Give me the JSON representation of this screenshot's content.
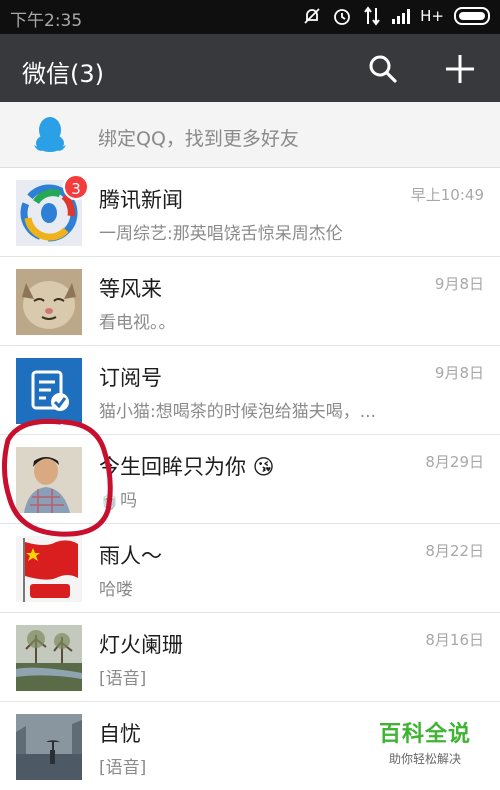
{
  "status_bar": {
    "time": "下午2:35",
    "network": "H+"
  },
  "header": {
    "title": "微信(3)",
    "search_icon": "search-icon",
    "add_icon": "plus-icon"
  },
  "bind_qq": {
    "text": "绑定QQ，找到更多好友",
    "icon": "qq-penguin-icon"
  },
  "chats": [
    {
      "name": "腾讯新闻",
      "preview": "一周综艺:那英唱饶舌惊呆周杰伦",
      "time": "早上10:49",
      "badge": "3"
    },
    {
      "name": "等风来",
      "preview": "看电视。。",
      "time": "9月8日"
    },
    {
      "name": "订阅号",
      "preview": "猫小猫:想喝茶的时候泡给猫夫喝，...",
      "time": "9月8日"
    },
    {
      "name": "今生回眸只为你 😘",
      "preview": "🍵吗",
      "time": "8月29日"
    },
    {
      "name": "雨人～",
      "preview": "哈喽",
      "time": "8月22日"
    },
    {
      "name": "灯火阑珊",
      "preview": "[语音]",
      "time": "8月16日"
    },
    {
      "name": "自忧",
      "preview": "[语音]",
      "time": ""
    }
  ],
  "watermark": {
    "title": "百科全说",
    "subtitle": "助你轻松解决"
  },
  "colors": {
    "titlebar": "#37393d",
    "badge": "#f43c3c",
    "annotation": "#c8102e",
    "watermark": "#3fb332"
  }
}
